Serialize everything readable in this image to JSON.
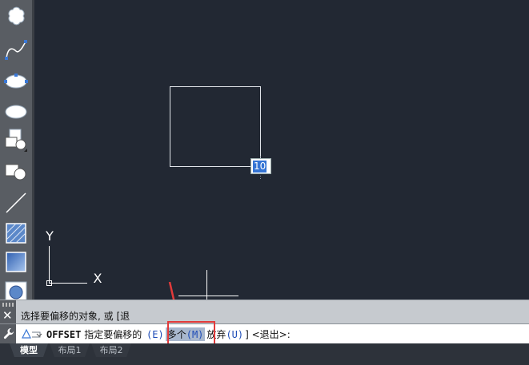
{
  "canvas": {
    "dynamic_input_value": "10",
    "ucs": {
      "x_label": "X",
      "y_label": "Y"
    }
  },
  "command_window": {
    "history_line": "选择要偏移的对象, 或 [退",
    "command_name": "OFFSET",
    "prompt": "指定要偏移的",
    "options": [
      {
        "label": "",
        "key": "(E)"
      },
      {
        "label": "多个",
        "key": "(M)"
      },
      {
        "label": "放弃",
        "key": "(U)"
      }
    ],
    "suffix": "] <退出>:"
  },
  "tabs": [
    {
      "label": "模型",
      "active": true
    },
    {
      "label": "布局1",
      "active": false
    },
    {
      "label": "布局2",
      "active": false
    }
  ],
  "toolbar": {
    "tools": [
      "revision-cloud-icon",
      "spline-icon",
      "ellipse-icon",
      "ellipse-arc-icon",
      "insert-block-icon",
      "make-block-icon",
      "line-icon",
      "hatch-icon",
      "gradient-icon",
      "region-icon"
    ]
  },
  "colors": {
    "canvas_bg": "#222833",
    "highlight": "#e23a3a",
    "option_key": "#1f4db8"
  }
}
